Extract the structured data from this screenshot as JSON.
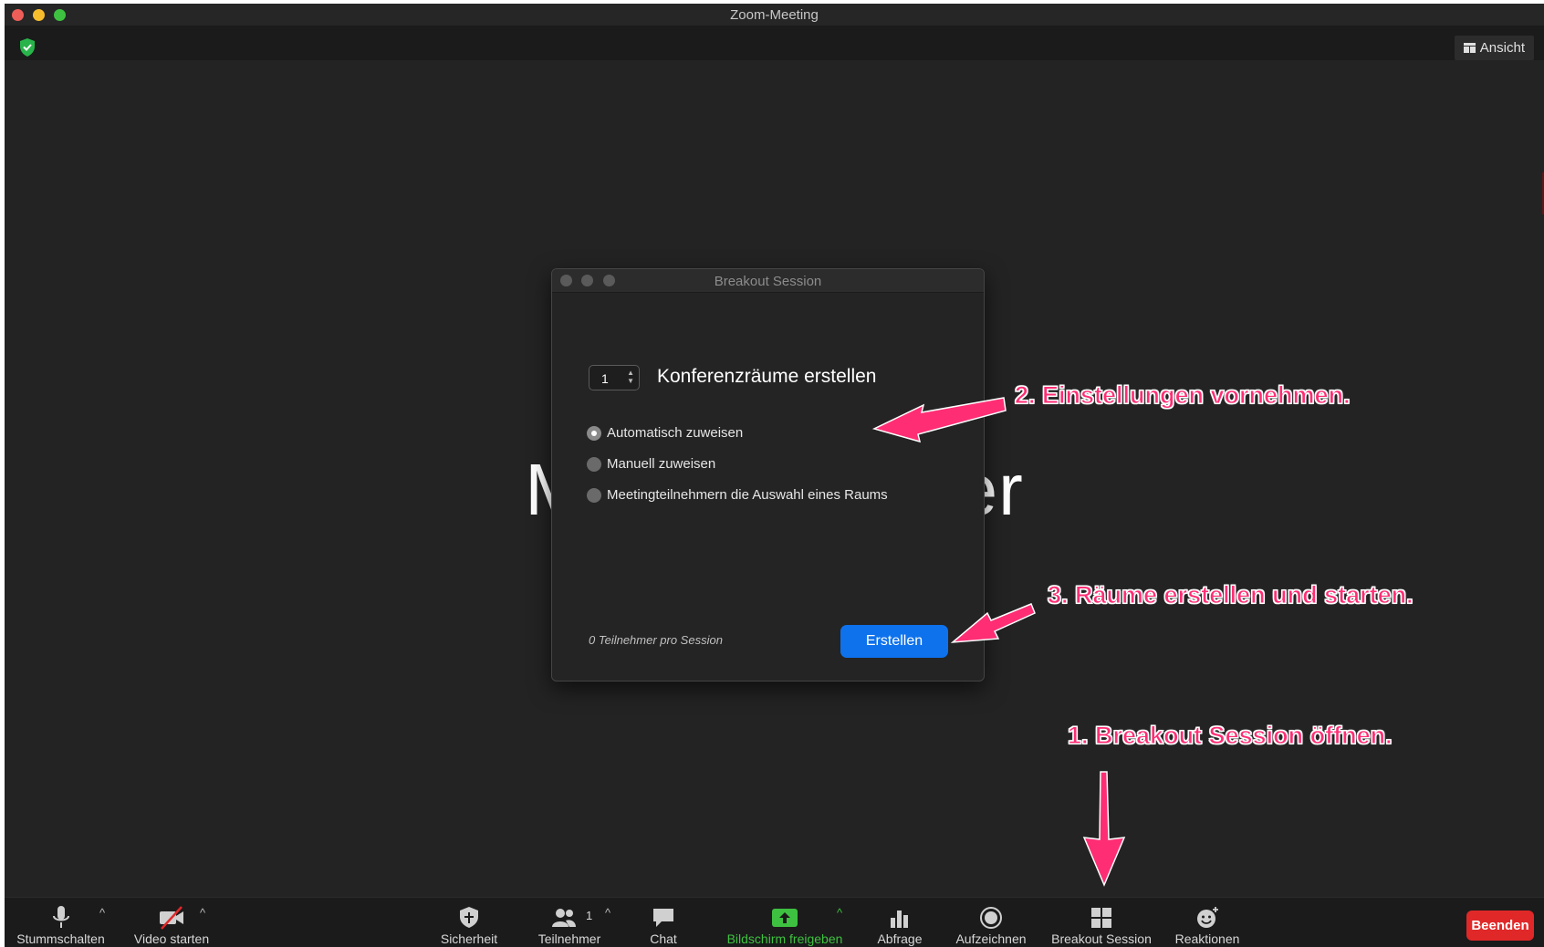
{
  "window": {
    "title": "Zoom-Meeting"
  },
  "topbar": {
    "view_label": "Ansicht"
  },
  "background_name": "Max Schneider",
  "dialog": {
    "title": "Breakout Session",
    "room_count": "1",
    "rooms_label": "Konferenzräume erstellen",
    "options": [
      {
        "label": "Automatisch zuweisen",
        "selected": true
      },
      {
        "label": "Manuell zuweisen",
        "selected": false
      },
      {
        "label": "Meetingteilnehmern die Auswahl eines Raums",
        "selected": false
      }
    ],
    "per_session": "0 Teilnehmer pro Session",
    "create_label": "Erstellen"
  },
  "annotations": {
    "step1": "1. Breakout Session öffnen.",
    "step2": "2. Einstellungen vornehmen.",
    "step3": "3. Räume erstellen und starten."
  },
  "toolbar": {
    "mute": "Stummschalten",
    "video": "Video starten",
    "security": "Sicherheit",
    "participants": "Teilnehmer",
    "participant_count": "1",
    "chat": "Chat",
    "share": "Bildschirm freigeben",
    "poll": "Abfrage",
    "record": "Aufzeichnen",
    "breakout": "Breakout Session",
    "reactions": "Reaktionen",
    "end": "Beenden"
  },
  "colors": {
    "accent_blue": "#0e72ed",
    "share_green": "#3ec140",
    "end_red": "#e02828",
    "annotation_pink": "#ff2d74"
  }
}
